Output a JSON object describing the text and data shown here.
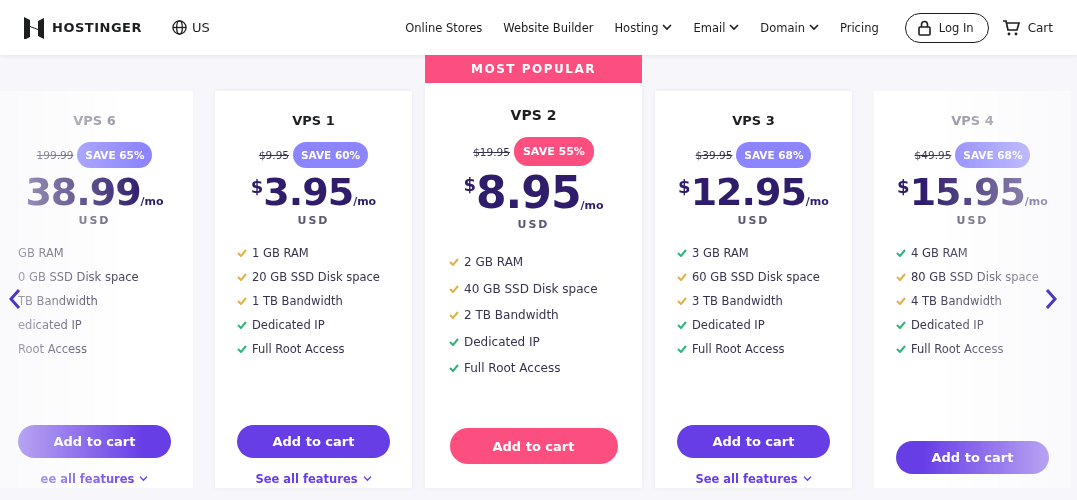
{
  "header": {
    "brand": "HOSTINGER",
    "region": "US",
    "nav": [
      {
        "label": "Online Stores",
        "dropdown": false
      },
      {
        "label": "Website Builder",
        "dropdown": false
      },
      {
        "label": "Hosting",
        "dropdown": true
      },
      {
        "label": "Email",
        "dropdown": true
      },
      {
        "label": "Domain",
        "dropdown": true
      },
      {
        "label": "Pricing",
        "dropdown": false
      }
    ],
    "login": "Log In",
    "cart": "Cart"
  },
  "plans": [
    {
      "faded": true,
      "popular": false,
      "name": "VPS 6",
      "old_price": "199.99",
      "save": "SAVE 65%",
      "price": "38.99",
      "per": "/mo",
      "unit": "USD",
      "features": [
        {
          "text": "GB RAM"
        },
        {
          "text": "0 GB SSD Disk space"
        },
        {
          "text": "TB Bandwidth"
        },
        {
          "text": "edicated IP"
        },
        {
          "text": "Root Access"
        }
      ],
      "cta": "Add to cart",
      "more": "ee all features"
    },
    {
      "faded": false,
      "popular": false,
      "name": "VPS 1",
      "old_price": "$9.95",
      "save": "SAVE 60%",
      "currency": "$",
      "price": "3.95",
      "per": "/mo",
      "unit": "USD",
      "features": [
        {
          "text": "1 GB RAM",
          "color": "#e0b04a"
        },
        {
          "text": "20 GB SSD Disk space",
          "color": "#e0b04a"
        },
        {
          "text": "1 TB Bandwidth",
          "color": "#e0b04a"
        },
        {
          "text": "Dedicated IP",
          "color": "#2fb37a"
        },
        {
          "text": "Full Root Access",
          "color": "#2fb37a"
        }
      ],
      "cta": "Add to cart",
      "more": "See all features"
    },
    {
      "faded": false,
      "popular": true,
      "badge": "MOST POPULAR",
      "name": "VPS 2",
      "old_price": "$19.95",
      "save": "SAVE 55%",
      "currency": "$",
      "price": "8.95",
      "per": "/mo",
      "unit": "USD",
      "features": [
        {
          "text": "2 GB RAM",
          "color": "#e0b04a"
        },
        {
          "text": "40 GB SSD Disk space",
          "color": "#e0b04a"
        },
        {
          "text": "2 TB Bandwidth",
          "color": "#e0b04a"
        },
        {
          "text": "Dedicated IP",
          "color": "#2fb37a"
        },
        {
          "text": "Full Root Access",
          "color": "#2fb37a"
        }
      ],
      "cta": "Add to cart"
    },
    {
      "faded": false,
      "popular": false,
      "name": "VPS 3",
      "old_price": "$39.95",
      "save": "SAVE 68%",
      "currency": "$",
      "price": "12.95",
      "per": "/mo",
      "unit": "USD",
      "features": [
        {
          "text": "3 GB RAM",
          "color": "#2fb37a"
        },
        {
          "text": "60 GB SSD Disk space",
          "color": "#e0b04a"
        },
        {
          "text": "3 TB Bandwidth",
          "color": "#e0b04a"
        },
        {
          "text": "Dedicated IP",
          "color": "#2fb37a"
        },
        {
          "text": "Full Root Access",
          "color": "#2fb37a"
        }
      ],
      "cta": "Add to cart",
      "more": "See all features"
    },
    {
      "faded": true,
      "popular": false,
      "name": "VPS 4",
      "old_price": "$49.95",
      "save": "SAVE 68%",
      "currency": "$",
      "price": "15.95",
      "per": "/mo",
      "unit": "USD",
      "features": [
        {
          "text": "4 GB RAM",
          "color": "#2fb37a"
        },
        {
          "text": "80 GB SSD Disk space",
          "color": "#e0b04a"
        },
        {
          "text": "4 TB Bandwidth",
          "color": "#e0b04a"
        },
        {
          "text": "Dedicated IP",
          "color": "#2fb37a"
        },
        {
          "text": "Full Root Access",
          "color": "#2fb37a"
        }
      ],
      "cta": "Add to cart"
    }
  ]
}
